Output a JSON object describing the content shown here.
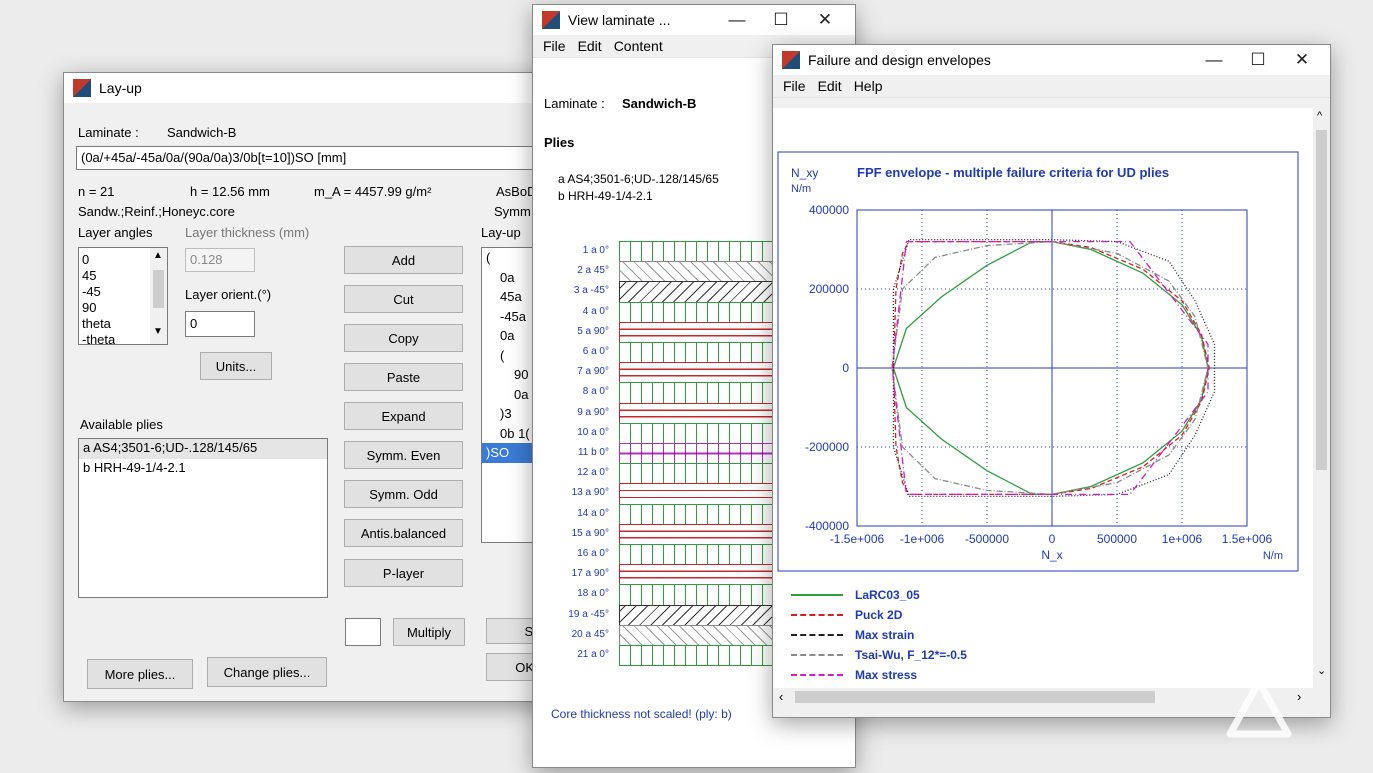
{
  "watermark_icon": "triangle-watermark-icon",
  "layup": {
    "title": "Lay-up",
    "laminate_label": "Laminate :",
    "laminate_name": "Sandwich-B",
    "code": "(0a/+45a/-45a/0a/(90a/0a)3/0b[t=10])SO [mm]",
    "n": "n =  21",
    "h": "h =   12.56 mm",
    "mA": "m_A =   4457.99 g/m²",
    "asbo": "AsBoD",
    "sandw": "Sandw.;Reinf.;Honeyc.core",
    "symm": "Symm",
    "angles_label": "Layer angles",
    "thickness_label": "Layer thickness (mm)",
    "thickness_value": "0.128",
    "orient_label": "Layer orient.(°)",
    "orient_value": "0",
    "layup_label": "Lay-up",
    "angles": [
      "0",
      "45",
      "-45",
      "90",
      "theta",
      "-theta"
    ],
    "units_btn": "Units...",
    "buttons": [
      "Add",
      "Cut",
      "Copy",
      "Paste",
      "Expand",
      "Symm. Even",
      "Symm. Odd",
      "Antis.balanced",
      "P-layer"
    ],
    "multiply_btn": "Multiply",
    "layup_items": [
      "(",
      "0a",
      "45a",
      "-45a",
      "0a",
      "(",
      "90",
      "0a",
      ")3",
      "0b 1(",
      ")SO"
    ],
    "available_label": "Available plies",
    "plies": [
      "a AS4;3501-6;UD-.128/145/65",
      "b HRH-49-1/4-2.1"
    ],
    "more_btn": "More plies...",
    "change_btn": "Change plies...",
    "s_btn": "Si",
    "ok_btn": "OK"
  },
  "view": {
    "title": "View laminate ...",
    "menu": [
      "File",
      "Edit",
      "Content"
    ],
    "laminate_label": "Laminate : ",
    "laminate_name": "Sandwich-B",
    "plies_heading": "Plies",
    "ply_types": [
      "a  AS4;3501-6;UD-.128/145/65",
      "b  HRH-49-1/4-2.1"
    ],
    "rows": [
      {
        "label": "1  a    0°",
        "kind": "zero"
      },
      {
        "label": "2  a   45°",
        "kind": "p45"
      },
      {
        "label": "3  a  -45°",
        "kind": "m45"
      },
      {
        "label": "4  a    0°",
        "kind": "zero"
      },
      {
        "label": "5  a   90°",
        "kind": "ninety"
      },
      {
        "label": "6  a    0°",
        "kind": "zero"
      },
      {
        "label": "7  a   90°",
        "kind": "ninety"
      },
      {
        "label": "8  a    0°",
        "kind": "zero"
      },
      {
        "label": "9  a   90°",
        "kind": "ninety"
      },
      {
        "label": "10  a    0°",
        "kind": "zero"
      },
      {
        "label": "11  b    0°",
        "kind": "core"
      },
      {
        "label": "12  a    0°",
        "kind": "zero"
      },
      {
        "label": "13  a   90°",
        "kind": "ninety"
      },
      {
        "label": "14  a    0°",
        "kind": "zero"
      },
      {
        "label": "15  a   90°",
        "kind": "ninety"
      },
      {
        "label": "16  a    0°",
        "kind": "zero"
      },
      {
        "label": "17  a   90°",
        "kind": "ninety"
      },
      {
        "label": "18  a    0°",
        "kind": "zero"
      },
      {
        "label": "19  a  -45°",
        "kind": "m45"
      },
      {
        "label": "20  a   45°",
        "kind": "p45"
      },
      {
        "label": "21  a    0°",
        "kind": "zero"
      }
    ],
    "footer": "Core thickness not scaled! (ply: b)",
    "colors": {
      "zero": "#2e9e3e",
      "ninety": "#c62828",
      "core": "#b030c0",
      "angle": "#333333"
    }
  },
  "envelope": {
    "title": "Failure and design envelopes",
    "menu": [
      "File",
      "Edit",
      "Help"
    ],
    "chart_data": {
      "type": "line",
      "title": "FPF envelope - multiple failure criteria for UD plies",
      "ylabel": "N_xy",
      "yunit": "N/m",
      "xlabel": "N_x",
      "xunit": "N/m",
      "xlim": [
        -1500000,
        1500000
      ],
      "ylim": [
        -400000,
        400000
      ],
      "xticks": [
        -1500000,
        -1000000,
        -500000,
        0,
        500000,
        1000000,
        1500000
      ],
      "xtick_labels": [
        "-1.5e+006",
        "-1e+006",
        "-500000",
        "0",
        "500000",
        "1e+006",
        "1.5e+006"
      ],
      "yticks": [
        400000,
        200000,
        0,
        -200000,
        -400000
      ],
      "ytick_labels": [
        "400000",
        "200000",
        "0",
        "-200000",
        "-400000"
      ],
      "grid": true,
      "series": [
        {
          "name": "LaRC03_05",
          "color": "#2e9e3e",
          "dash": "",
          "x": [
            -1220000,
            -1120000,
            -850000,
            -500000,
            -150000,
            0,
            300000,
            700000,
            1000000,
            1150000,
            1200000,
            1150000,
            1000000,
            700000,
            300000,
            0,
            -150000,
            -500000,
            -850000,
            -1120000,
            -1220000
          ],
          "y": [
            0,
            100000,
            180000,
            260000,
            320000,
            320000,
            300000,
            240000,
            160000,
            80000,
            0,
            -80000,
            -160000,
            -240000,
            -300000,
            -320000,
            -320000,
            -260000,
            -180000,
            -100000,
            0
          ]
        },
        {
          "name": "Puck 2D",
          "color": "#d62020",
          "dash": "5,3",
          "x": [
            -1220000,
            -1200000,
            -1150000,
            -1100000,
            0,
            300000,
            700000,
            1000000,
            1150000,
            1210000,
            1150000,
            1000000,
            700000,
            300000,
            0,
            -1100000,
            -1150000,
            -1200000,
            -1220000
          ],
          "y": [
            0,
            200000,
            290000,
            320000,
            320000,
            305000,
            250000,
            170000,
            85000,
            0,
            -85000,
            -170000,
            -250000,
            -305000,
            -320000,
            -320000,
            -290000,
            -200000,
            0
          ]
        },
        {
          "name": "Max strain",
          "color": "#222222",
          "dash": "1,2",
          "x": [
            -1220000,
            -1220000,
            -1100000,
            0,
            500000,
            900000,
            1100000,
            1250000,
            1250000,
            1100000,
            900000,
            500000,
            0,
            -1100000,
            -1220000,
            -1220000
          ],
          "y": [
            0,
            200000,
            325000,
            325000,
            320000,
            270000,
            170000,
            60000,
            -60000,
            -170000,
            -270000,
            -320000,
            -325000,
            -325000,
            -200000,
            0
          ]
        },
        {
          "name": "Tsai-Wu, F_12*=-0.5",
          "color": "#8a8a8a",
          "dash": "6,2,1,2",
          "x": [
            -1230000,
            -1150000,
            -900000,
            -500000,
            0,
            500000,
            900000,
            1100000,
            1200000,
            1100000,
            900000,
            500000,
            0,
            -500000,
            -900000,
            -1150000,
            -1230000
          ],
          "y": [
            0,
            200000,
            280000,
            310000,
            320000,
            290000,
            220000,
            130000,
            0,
            -130000,
            -220000,
            -290000,
            -320000,
            -310000,
            -280000,
            -200000,
            0
          ]
        },
        {
          "name": "Max stress",
          "color": "#d01ec8",
          "dash": "7,3,1,3",
          "x": [
            -1230000,
            -1120000,
            600000,
            1200000,
            1200000,
            600000,
            -1120000,
            -1230000
          ],
          "y": [
            0,
            320000,
            320000,
            60000,
            -60000,
            -320000,
            -320000,
            0
          ]
        }
      ]
    }
  }
}
